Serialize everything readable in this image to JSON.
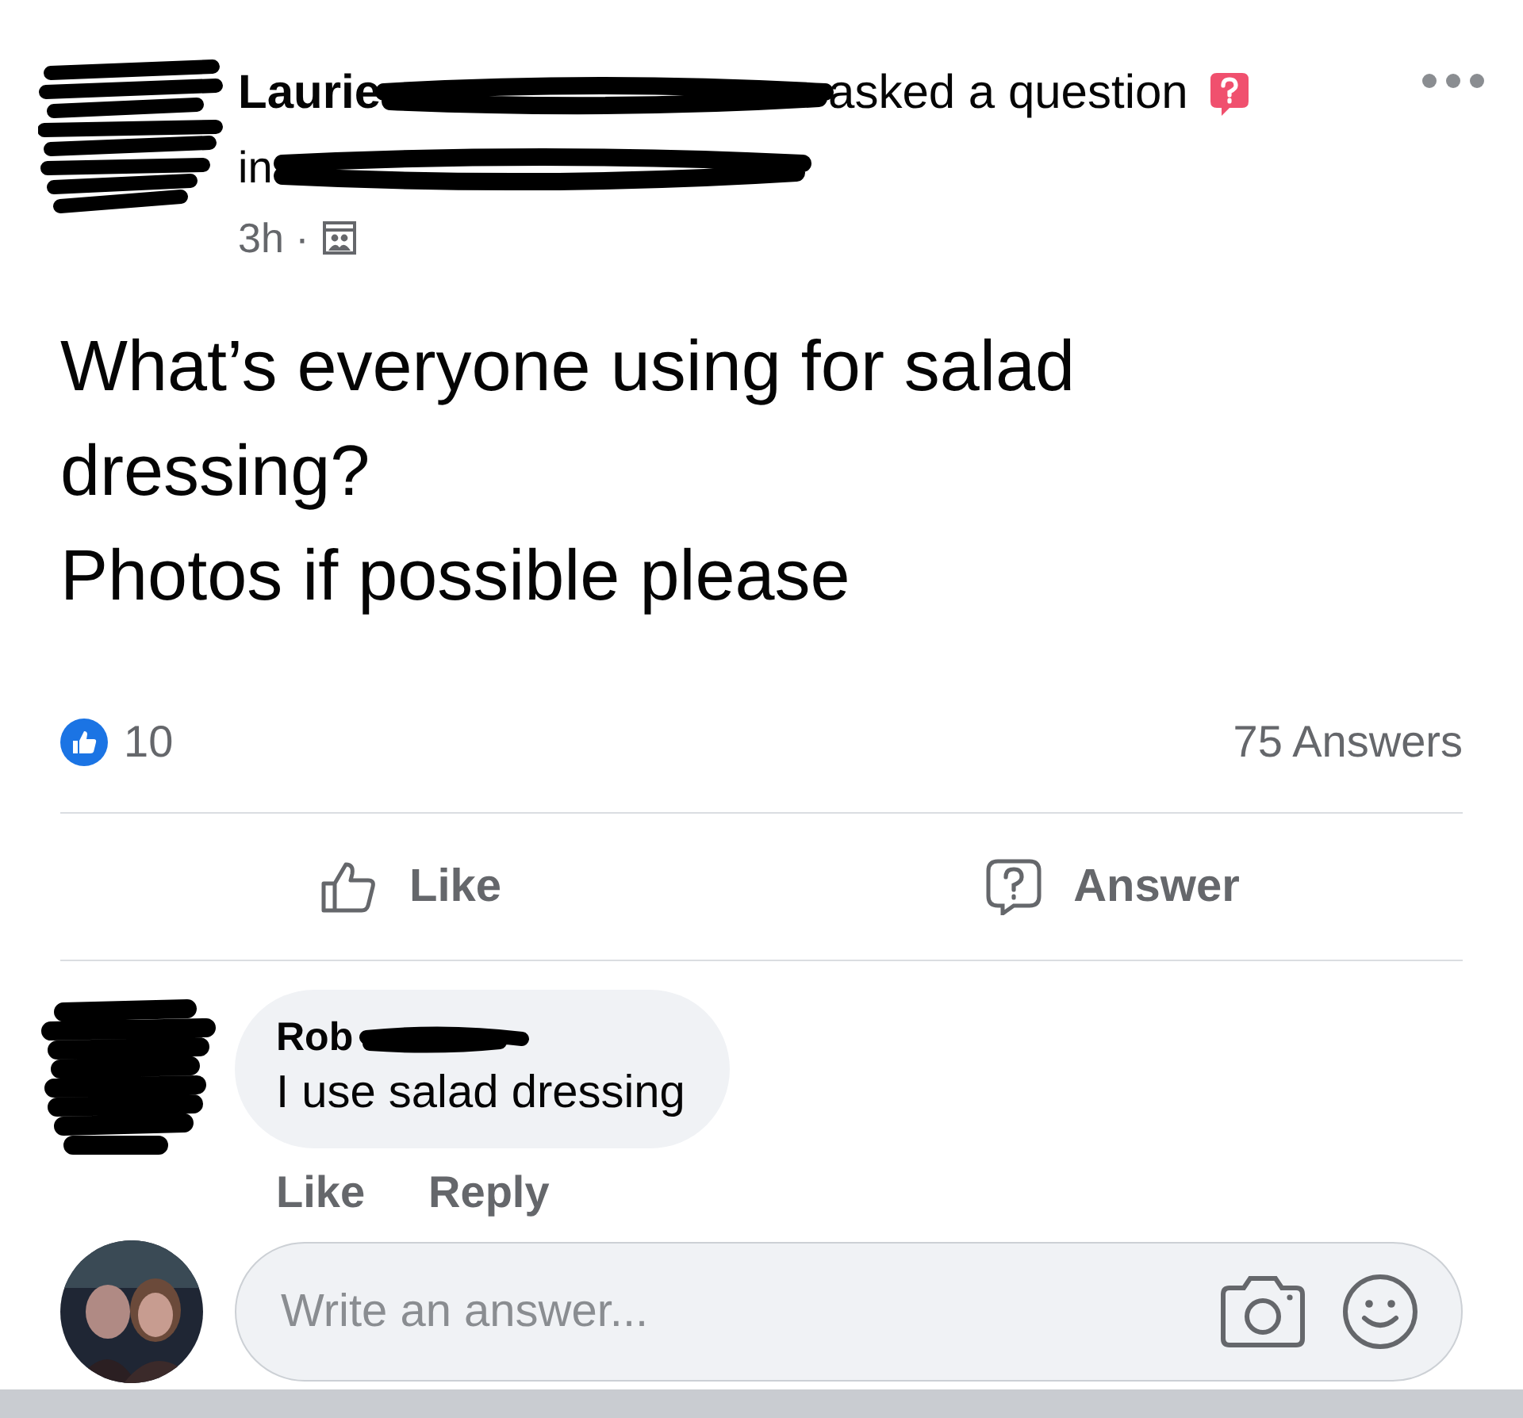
{
  "post": {
    "author": "Laurie",
    "action": "asked a question",
    "group_prefix": "in",
    "time": "3h ·",
    "paragraphs": [
      "What’s everyone using for salad dressing?",
      "Photos if possible please"
    ],
    "like_count": "10",
    "answer_count": "75 Answers",
    "actions": [
      {
        "kind": "like",
        "label": "Like"
      },
      {
        "kind": "answer",
        "label": "Answer"
      }
    ]
  },
  "comments": [
    {
      "author": "Rob",
      "text": "I use salad dressing",
      "actions": [
        "Like",
        "Reply"
      ]
    }
  ],
  "composer": {
    "placeholder": "Write an answer..."
  }
}
